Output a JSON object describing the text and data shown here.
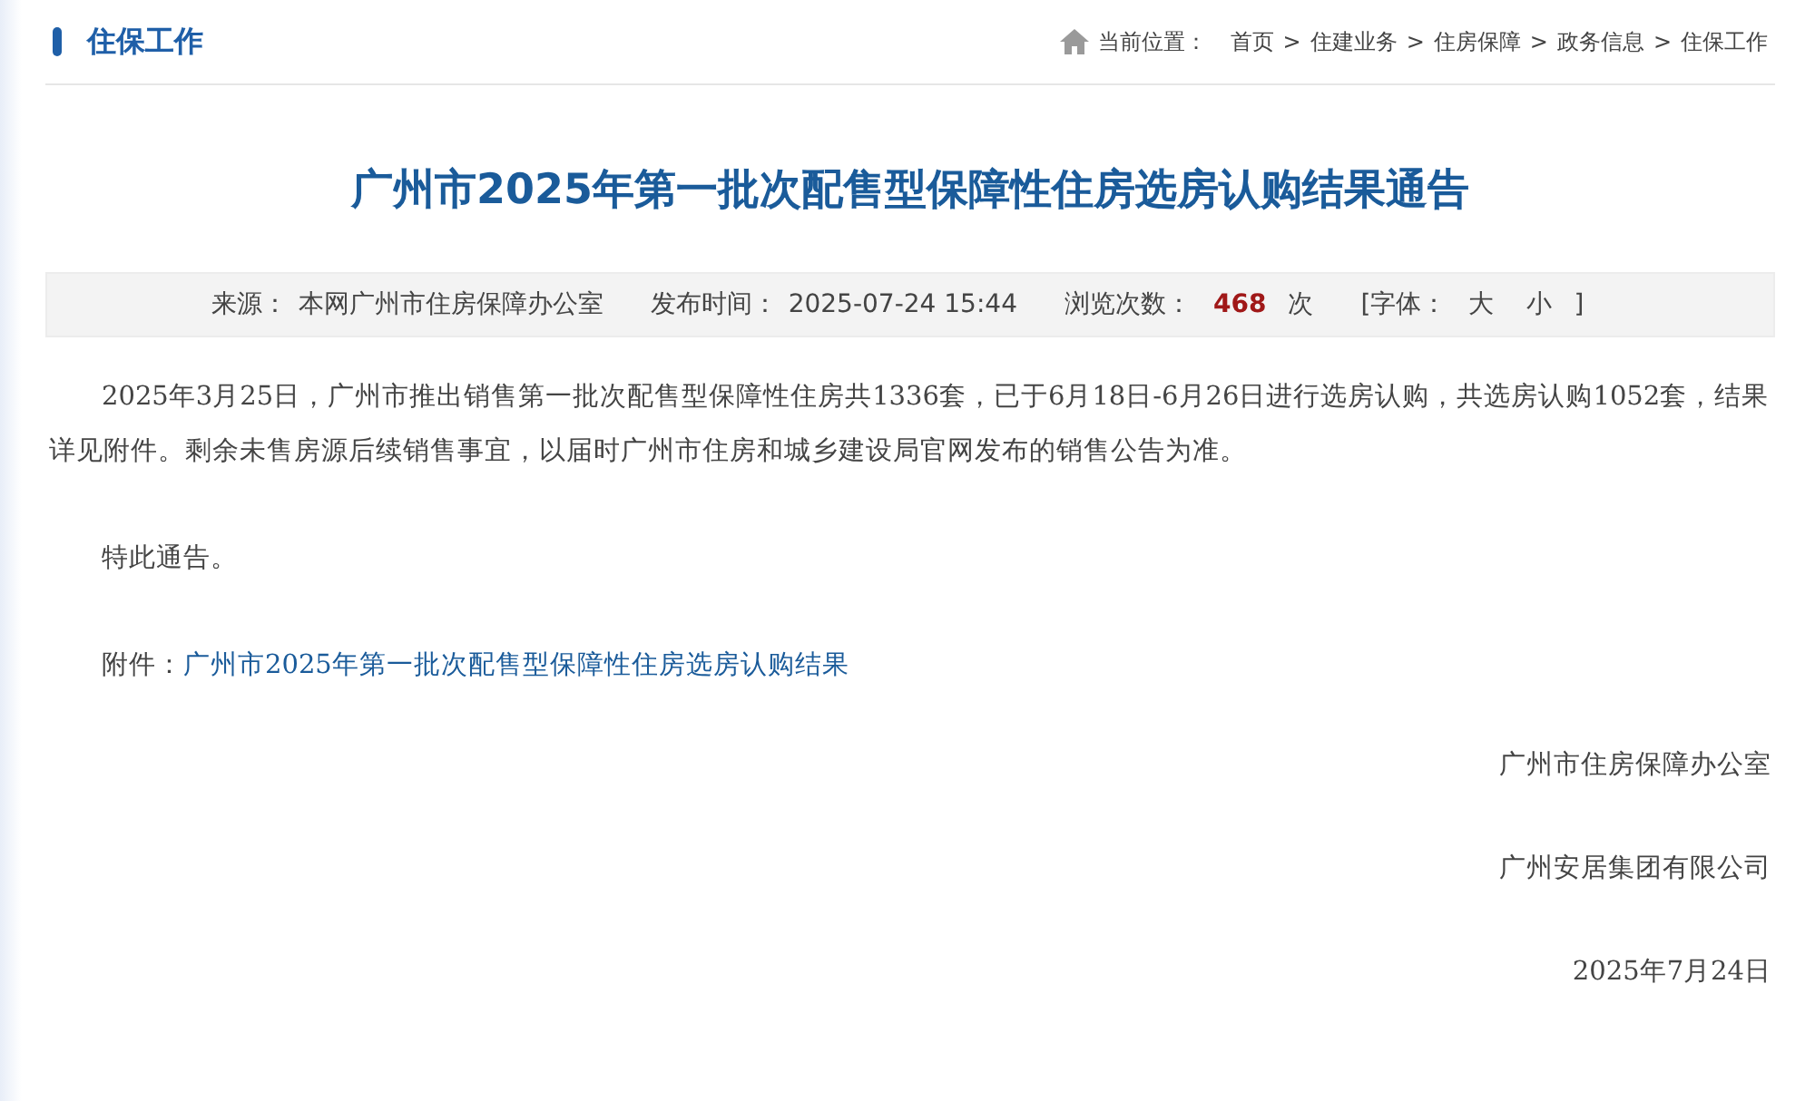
{
  "section_title": "住保工作",
  "breadcrumb": {
    "label": "当前位置：",
    "items": [
      {
        "text": "首页"
      },
      {
        "text": "住建业务"
      },
      {
        "text": "住房保障"
      },
      {
        "text": "政务信息"
      },
      {
        "text": "住保工作"
      }
    ],
    "separator": ">"
  },
  "article": {
    "title": "广州市2025年第一批次配售型保障性住房选房认购结果通告",
    "meta": {
      "source_label": "来源：",
      "source": "本网广州市住房保障办公室",
      "time_label": "发布时间：",
      "time": "2025-07-24 15:44",
      "views_label": "浏览次数：",
      "views": "468",
      "views_unit": "次",
      "font_label": "[字体：",
      "font_large": "大",
      "font_small": "小",
      "font_close": "]"
    },
    "paragraphs": [
      "2025年3月25日，广州市推出销售第一批次配售型保障性住房共1336套，已于6月18日-6月26日进行选房认购，共选房认购1052套，结果详见附件。剩余未售房源后续销售事宜，以届时广州市住房和城乡建设局官网发布的销售公告为准。",
      "特此通告。"
    ],
    "attachment": {
      "label": "附件：",
      "link": "广州市2025年第一批次配售型保障性住房选房认购结果"
    },
    "signatures": [
      "广州市住房保障办公室",
      "广州安居集团有限公司",
      "2025年7月24日"
    ]
  }
}
